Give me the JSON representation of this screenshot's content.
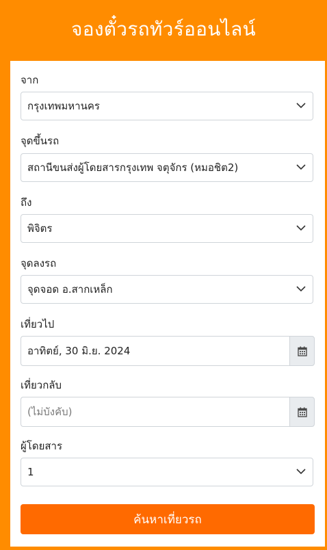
{
  "header": {
    "title": "จองตั๋วรถทัวร์ออนไลน์"
  },
  "form": {
    "from": {
      "label": "จาก",
      "value": "กรุงเทพมหานคร"
    },
    "pickup": {
      "label": "จุดขึ้นรถ",
      "value": "สถานีขนส่งผู้โดยสารกรุงเทพ จตุจักร (หมอชิต2)"
    },
    "to": {
      "label": "ถึง",
      "value": "พิจิตร"
    },
    "dropoff": {
      "label": "จุดลงรถ",
      "value": "จุดจอด อ.สากเหล็ก"
    },
    "depart": {
      "label": "เที่ยวไป",
      "value": "อาทิตย์, 30 มิ.ย. 2024"
    },
    "return": {
      "label": "เที่ยวกลับ",
      "placeholder": "(ไม่บังคับ)"
    },
    "passengers": {
      "label": "ผู้โดยสาร",
      "value": "1"
    },
    "submit_label": "ค้นหาเที่ยวรถ"
  },
  "colors": {
    "brand": "#ff8c00",
    "button": "#ff6a00"
  },
  "icons": {
    "select": "chevron-down-icon",
    "date": "calendar-icon"
  }
}
